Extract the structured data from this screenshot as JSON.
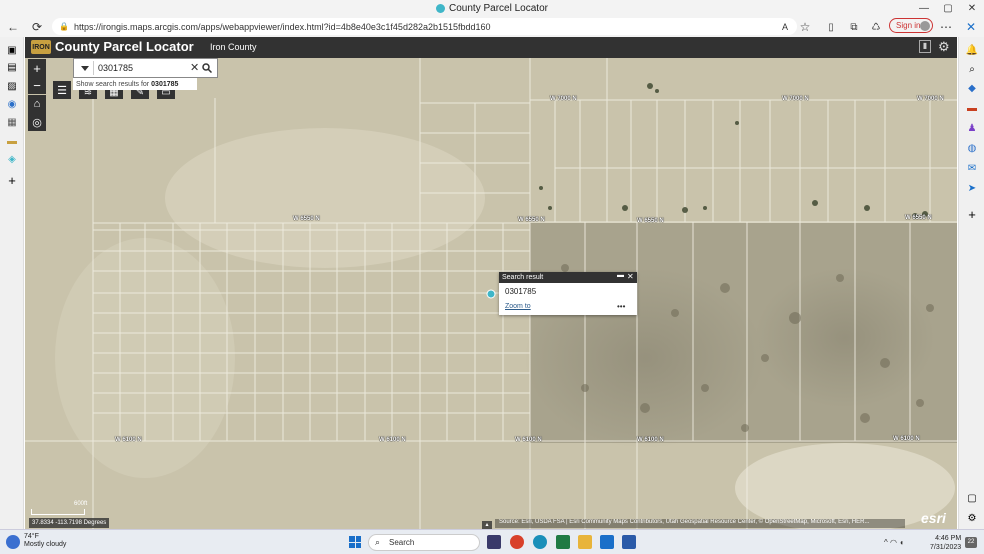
{
  "browser": {
    "tab_title": "County Parcel Locator",
    "url": "https://irongis.maps.arcgis.com/apps/webappviewer/index.html?id=4b8e40e3c1f45d282a2b1515fbdd160",
    "signin_label": "Sign in"
  },
  "app": {
    "logo_text": "IRON",
    "title": "County Parcel Locator",
    "subtitle": "Iron County"
  },
  "search": {
    "value": "0301785",
    "suggestion_prefix": "Show search results for",
    "suggestion_term": "0301785"
  },
  "popup": {
    "header": "Search result",
    "title": "0301785",
    "zoom_link": "Zoom to",
    "more": "•••"
  },
  "map": {
    "road_labels": [
      "W 7000 N",
      "W 7000 N",
      "W 7000 N",
      "W 6550 N",
      "W 6550 N",
      "W 6550 N",
      "W 6550 N",
      "W 6100 N",
      "W 6100 N",
      "W 6100 N",
      "W 6100 N",
      "W 6100 N"
    ],
    "coords": "37.8334 -113.7198 Degrees",
    "scale_label": "600ft",
    "attribution": "Source: Esri, USDA FSA | Esri Community Maps Contributors, Utah Geospatial Resource Center, © OpenStreetMap, Microsoft, Esri, HER...",
    "esri_logo": "esri"
  },
  "taskbar": {
    "temperature": "74°F",
    "weather": "Mostly cloudy",
    "search_label": "Search",
    "time": "4:46 PM",
    "date": "7/31/2023",
    "notification_count": "22"
  },
  "colors": {
    "header_bg": "#323232",
    "accent": "#2a5a8a",
    "marker": "#3fb6c8"
  }
}
